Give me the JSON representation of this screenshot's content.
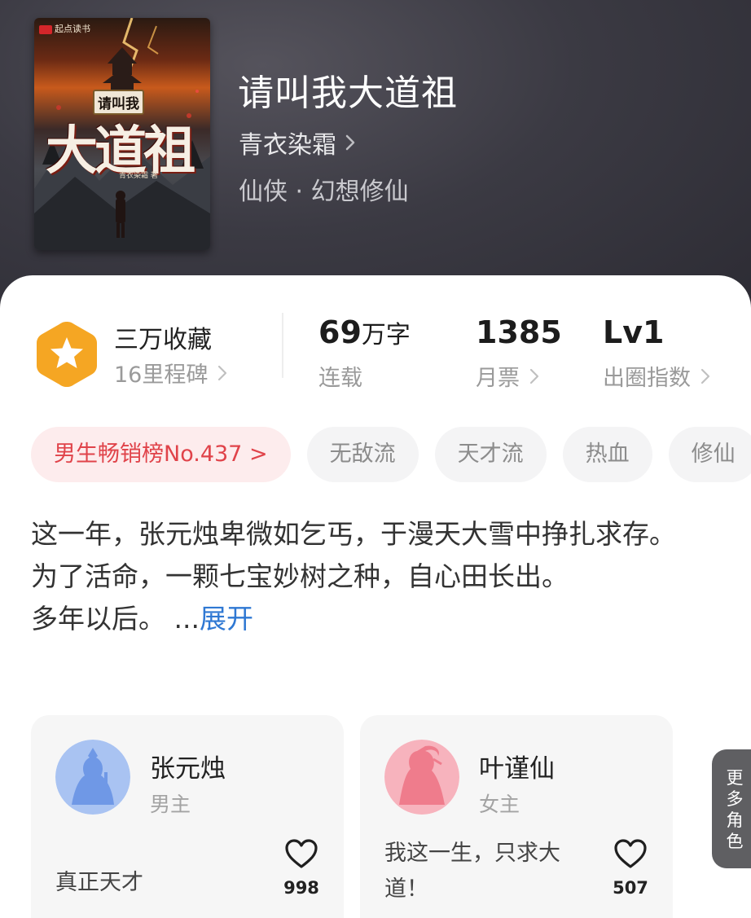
{
  "book": {
    "title": "请叫我大道祖",
    "author": "青衣染霜",
    "genre": "仙侠 · 幻想修仙",
    "cover": {
      "publisher": "起点读书",
      "title_small": "请叫我",
      "title_big": "大道祖",
      "author": "青衣染霜 著"
    }
  },
  "stats": {
    "collections": "三万收藏",
    "milestones": "16里程碑",
    "word_count_number": "69",
    "word_count_unit": "万字",
    "status": "连载",
    "monthly_tickets": "1385",
    "monthly_tickets_label": "月票",
    "level": "Lv1",
    "level_label": "出圈指数"
  },
  "tags": [
    {
      "label": "男生畅销榜No.437 >"
    },
    {
      "label": "无敌流"
    },
    {
      "label": "天才流"
    },
    {
      "label": "热血"
    },
    {
      "label": "修仙"
    }
  ],
  "synopsis": {
    "paragraphs": [
      "这一年，张元烛卑微如乞丐，于漫天大雪中挣扎求存。",
      "为了活命，一颗七宝妙树之种，自心田长出。",
      "多年以后。 ..."
    ],
    "expand_label": "展开"
  },
  "characters": [
    {
      "name": "张元烛",
      "role": "男主",
      "quote": "真正天才",
      "likes": "998",
      "avatar_color": "#7ea5ea"
    },
    {
      "name": "叶谨仙",
      "role": "女主",
      "quote": "我这一生，只求大道！",
      "likes": "507",
      "avatar_color": "#f08a98"
    }
  ],
  "more_roles": {
    "chars": [
      "更",
      "多",
      "角",
      "色"
    ]
  },
  "colors": {
    "accent_red": "#e0434a",
    "link_blue": "#2f78d3",
    "badge_orange": "#f5a623"
  }
}
